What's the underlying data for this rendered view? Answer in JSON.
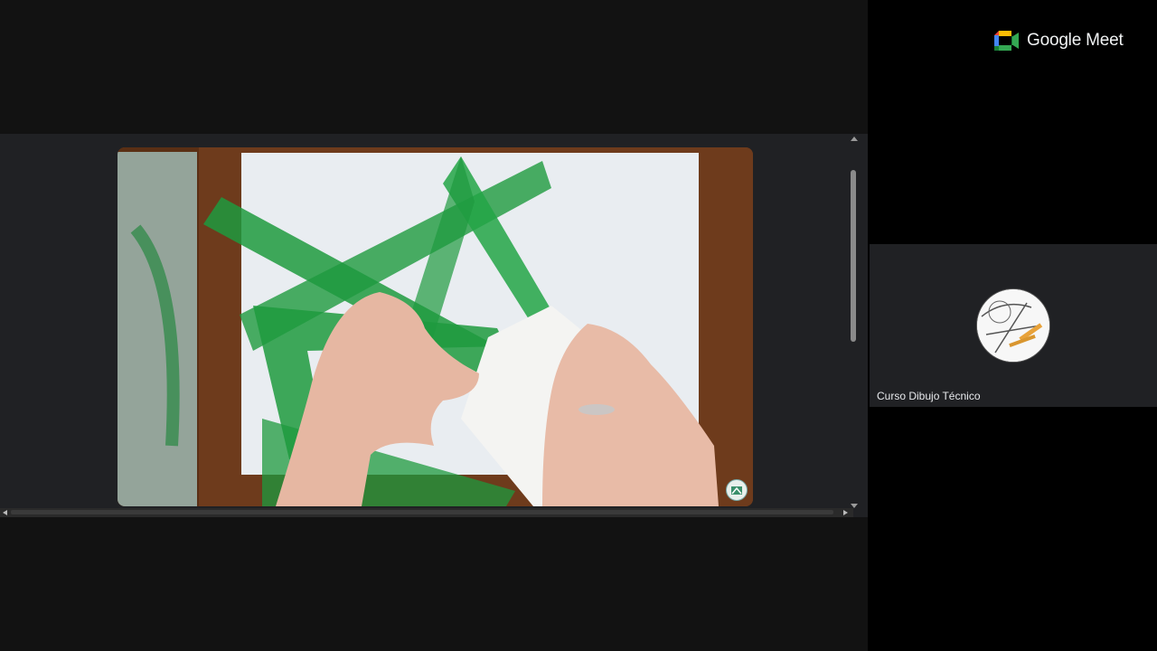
{
  "app": {
    "brand_name": "Google Meet"
  },
  "presentation": {
    "description_icon": "channel-logo-icon"
  },
  "participant": {
    "name": "Curso Dibujo Técnico",
    "avatar_icon": "drawing-tools-avatar"
  },
  "colors": {
    "stage_bg": "#121212",
    "share_bg": "#202124",
    "tile_bg": "#202124",
    "sidebar_bg": "#000000",
    "text_light": "#e8eaed",
    "ruler_green": "#1e9a3e"
  }
}
